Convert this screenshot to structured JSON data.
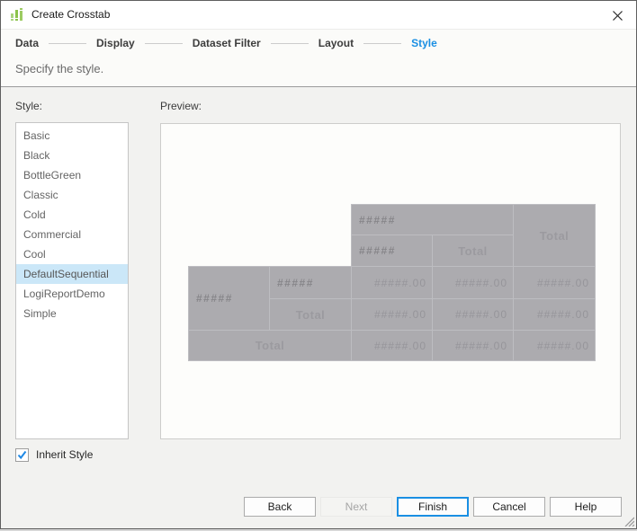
{
  "window": {
    "title": "Create Crosstab"
  },
  "icons": {
    "app_icon": "green-equalizer-bars",
    "close_icon": "x-cross",
    "checkbox_check_icon": "blue-checkmark",
    "resize_grip_icon": "diagonal-hatch"
  },
  "colors": {
    "accent_blue": "#1a8fe3",
    "active_step": "#1a8fe3",
    "selected_item_bg": "#cbe7f8",
    "crosstab_cell_bg": "#acabaf",
    "crosstab_cell_border": "#bdbdc1",
    "icon_green": "#8bc34a"
  },
  "steps": {
    "active_index": 4,
    "items": [
      {
        "label": "Data"
      },
      {
        "label": "Display"
      },
      {
        "label": "Dataset Filter"
      },
      {
        "label": "Layout"
      },
      {
        "label": "Style"
      }
    ]
  },
  "description": "Specify the style.",
  "style_panel": {
    "label": "Style:",
    "selected_index": 7,
    "selected": "DefaultSequential",
    "items": [
      "Basic",
      "Black",
      "BottleGreen",
      "Classic",
      "Cold",
      "Commercial",
      "Cool",
      "DefaultSequential",
      "LogiReportDemo",
      "Simple"
    ]
  },
  "preview_panel": {
    "label": "Preview:",
    "crosstab": {
      "hash": "#####",
      "value": "#####.00",
      "total": "Total"
    }
  },
  "inherit_checkbox": {
    "label": "Inherit Style",
    "checked": true
  },
  "buttons": [
    {
      "label": "Back",
      "state": "normal"
    },
    {
      "label": "Next",
      "state": "disabled"
    },
    {
      "label": "Finish",
      "state": "default"
    },
    {
      "label": "Cancel",
      "state": "normal"
    },
    {
      "label": "Help",
      "state": "normal"
    }
  ]
}
